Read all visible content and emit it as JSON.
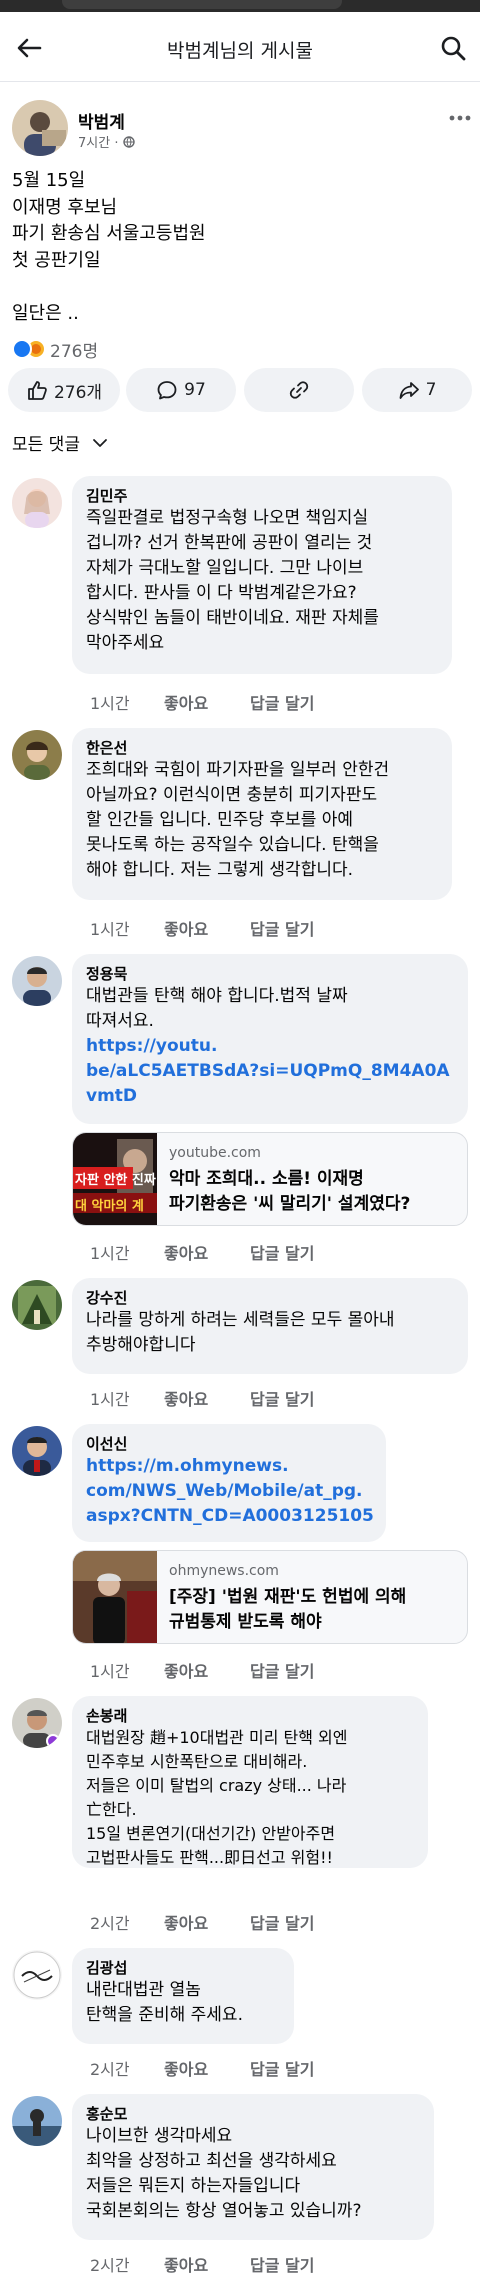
{
  "header": {
    "title": "박범계님의 게시물"
  },
  "post": {
    "author": "박범계",
    "time": "7시간",
    "privacy_sep": "·",
    "lines": [
      "5월 15일",
      "이재명 후보님",
      "파기 환송심 서울고등법원",
      "첫 공판기일",
      "",
      "일단은 .."
    ],
    "reaction_count": "276명",
    "actions": {
      "like": "276개",
      "comment": "97",
      "share": "7"
    }
  },
  "filter": {
    "label": "모든 댓글"
  },
  "comments": [
    {
      "name": "김민주",
      "lines": [
        "즉일판결로 법정구속형 나오면 책임지실",
        "겁니까? 선거 한복판에 공판이 열리는 것",
        "자체가 극대노할 일입니다. 그만 나이브",
        "합시다. 판사들 이 다 박범계같은가요?",
        "상식밖인 놈들이 태반이네요. 재판 자체를",
        "막아주세요"
      ],
      "time": "1시간",
      "like": "좋아요",
      "reply": "답글 달기"
    },
    {
      "name": "한은선",
      "lines": [
        "조희대와 국힘이 파기자판을 일부러 안한건",
        "아닐까요? 이런식이면 충분히 피기자판도",
        "할 인간들 입니다. 민주당 후보를 아예",
        "못나도록 하는 공작일수 있습니다. 탄핵을",
        "해야 합니다. 저는 그렇게 생각합니다."
      ],
      "time": "1시간",
      "like": "좋아요",
      "reply": "답글 달기"
    },
    {
      "name": "정용묵",
      "lines": [
        "대법관들 탄핵 해야 합니다.법적 날짜",
        "따져서요."
      ],
      "link_lines": [
        "https://youtu.",
        "be/aLC5AETBSdA?si=UQPmQ_8M4A0A",
        "vmtD"
      ],
      "card": {
        "domain": "youtube.com",
        "title_lines": [
          "악마 조희대.. 소름! 이재명",
          "파기환송은 '씨 말리기' 설계였다?"
        ],
        "thumb_text": [
          "자판 안한 진짜",
          "대 악마의 계"
        ]
      },
      "time": "1시간",
      "like": "좋아요",
      "reply": "답글 달기"
    },
    {
      "name": "강수진",
      "lines": [
        "나라를 망하게 하려는 세력들은 모두 몰아내",
        "추방해야합니다"
      ],
      "time": "1시간",
      "like": "좋아요",
      "reply": "답글 달기"
    },
    {
      "name": "이선신",
      "link_lines": [
        "https://m.ohmynews.",
        "com/NWS_Web/Mobile/at_pg.",
        "aspx?CNTN_CD=A0003125105"
      ],
      "card": {
        "domain": "ohmynews.com",
        "title_lines": [
          "[주장] '법원 재판'도 헌법에 의해",
          "규범통제 받도록 해야"
        ]
      },
      "time": "1시간",
      "like": "좋아요",
      "reply": "답글 달기"
    },
    {
      "name": "손봉래",
      "lines": [
        "대법원장 趙+10대법관 미리 탄핵 외엔",
        "민주후보 시한폭탄으로 대비해라.",
        "저들은 이미 탈법의 crazy 상태... 나라",
        "亡한다.",
        "15일 변론연기(대선기간) 안받아주면",
        "고법판사들도 판핵...即日선고 위험!!"
      ],
      "time": "2시간",
      "like": "좋아요",
      "reply": "답글 달기"
    },
    {
      "name": "김광섭",
      "lines": [
        "내란대법관 열놈",
        "탄핵을 준비해 주세요."
      ],
      "time": "2시간",
      "like": "좋아요",
      "reply": "답글 달기"
    },
    {
      "name": "홍순모",
      "lines": [
        "나이브한 생각마세요",
        "최악을 상정하고 최선을 생각하세요",
        "저들은 뭐든지 하는자들입니다",
        "국회본회의는 항상 열어놓고 있습니까?"
      ],
      "time": "2시간",
      "like": "좋아요",
      "reply": "답글 달기"
    }
  ],
  "colors": {
    "link": "#216fdb",
    "bubble": "#f0f2f5",
    "secondary_text": "#65676b",
    "like_blue": "#1877f2"
  }
}
